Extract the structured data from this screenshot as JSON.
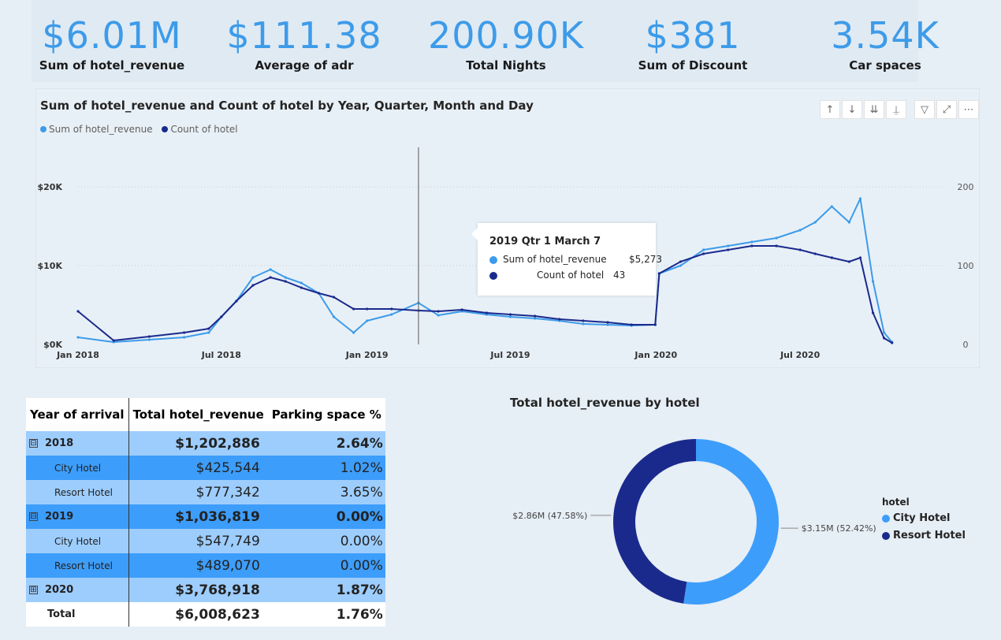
{
  "kpis": [
    {
      "value": "$6.01M",
      "label": "Sum of hotel_revenue"
    },
    {
      "value": "$111.38",
      "label": "Average of adr"
    },
    {
      "value": "200.90K",
      "label": "Total Nights"
    },
    {
      "value": "$381",
      "label": "Sum of Discount"
    },
    {
      "value": "3.54K",
      "label": "Car spaces"
    }
  ],
  "line_chart": {
    "title": "Sum of hotel_revenue and Count of hotel by Year, Quarter, Month and Day",
    "toolbar": [
      "drill-up-icon",
      "drill-down-icon",
      "expand-all-icon",
      "expand-hierarchy-icon",
      "filter-icon",
      "focus-mode-icon",
      "more-options-icon"
    ],
    "tooltip": {
      "title": "2019 Qtr 1 March 7",
      "rows": [
        {
          "name": "Sum of hotel_revenue",
          "value": "$5,273",
          "color": "#3d9be9"
        },
        {
          "name": "Count of hotel",
          "value": "43",
          "color": "#1a2a8c"
        }
      ]
    }
  },
  "chart_data": [
    {
      "type": "line",
      "title": "Sum of hotel_revenue and Count of hotel by Year, Quarter, Month and Day",
      "x_ticks": [
        "Jan 2018",
        "Jul 2018",
        "Jan 2019",
        "Jul 2019",
        "Jan 2020",
        "Jul 2020"
      ],
      "y_ticks": [
        "$0K",
        "$10K",
        "$20K"
      ],
      "y2_ticks": [
        "0",
        "100",
        "200"
      ],
      "ylim": [
        0,
        20000
      ],
      "y2lim": [
        0,
        200
      ],
      "grid": true,
      "legend": "top-left",
      "x": [
        "2018-01-01",
        "2018-02-15",
        "2018-04-01",
        "2018-05-15",
        "2018-06-15",
        "2018-07-01",
        "2018-07-20",
        "2018-08-10",
        "2018-09-01",
        "2018-09-20",
        "2018-10-10",
        "2018-11-01",
        "2018-11-20",
        "2018-12-15",
        "2019-01-01",
        "2019-02-01",
        "2019-03-07",
        "2019-04-01",
        "2019-05-01",
        "2019-06-01",
        "2019-07-01",
        "2019-08-01",
        "2019-09-01",
        "2019-10-01",
        "2019-11-01",
        "2019-12-01",
        "2019-12-31",
        "2020-01-05",
        "2020-02-01",
        "2020-03-01",
        "2020-04-01",
        "2020-05-01",
        "2020-06-01",
        "2020-07-01",
        "2020-07-20",
        "2020-08-10",
        "2020-09-01",
        "2020-09-15",
        "2020-10-01",
        "2020-10-15",
        "2020-10-25"
      ],
      "series": [
        {
          "name": "Sum of hotel_revenue",
          "axis": "left",
          "color": "#3d9be9",
          "values": [
            900,
            300,
            600,
            900,
            1500,
            3500,
            5500,
            8500,
            9500,
            8500,
            7800,
            6500,
            3500,
            1500,
            3000,
            3800,
            5273,
            3700,
            4200,
            3800,
            3500,
            3300,
            3000,
            2600,
            2500,
            2400,
            2500,
            9000,
            10000,
            12000,
            12500,
            13000,
            13500,
            14500,
            15500,
            17500,
            15500,
            18500,
            8000,
            1500,
            300
          ]
        },
        {
          "name": "Count of hotel",
          "axis": "right",
          "color": "#1a2a8c",
          "values": [
            42,
            5,
            10,
            15,
            20,
            35,
            55,
            75,
            85,
            80,
            72,
            65,
            60,
            45,
            45,
            45,
            43,
            42,
            44,
            40,
            38,
            36,
            32,
            30,
            28,
            25,
            25,
            90,
            105,
            115,
            120,
            125,
            125,
            120,
            115,
            110,
            105,
            110,
            40,
            8,
            2
          ]
        }
      ]
    },
    {
      "type": "pie",
      "donut": true,
      "title": "Total hotel_revenue by hotel",
      "legend_title": "hotel",
      "legend": "right",
      "categories": [
        "City Hotel",
        "Resort Hotel"
      ],
      "values": [
        3150000,
        2860000
      ],
      "labels": [
        "$3.15M (52.42%)",
        "$2.86M (47.58%)"
      ],
      "colors": [
        "#3d9dfa",
        "#1a2a8c"
      ]
    }
  ],
  "matrix": {
    "headers": [
      "Year of arrival",
      "Total hotel_revenue",
      "Parking space %"
    ],
    "rows": [
      {
        "label": "2018",
        "revenue": "$1,202,886",
        "parking": "2.64%"
      },
      {
        "label": "City Hotel",
        "revenue": "$425,544",
        "parking": "1.02%"
      },
      {
        "label": "Resort Hotel",
        "revenue": "$777,342",
        "parking": "3.65%"
      },
      {
        "label": "2019",
        "revenue": "$1,036,819",
        "parking": "0.00%"
      },
      {
        "label": "City Hotel",
        "revenue": "$547,749",
        "parking": "0.00%"
      },
      {
        "label": "Resort Hotel",
        "revenue": "$489,070",
        "parking": "0.00%"
      },
      {
        "label": "2020",
        "revenue": "$3,768,918",
        "parking": "1.87%"
      },
      {
        "label": "Total",
        "revenue": "$6,008,623",
        "parking": "1.76%"
      }
    ],
    "expanders": [
      "⊟",
      "⊟",
      "⊞"
    ]
  },
  "colors": {
    "accent": "#3d9be9",
    "dark_series": "#1a2a8c"
  }
}
